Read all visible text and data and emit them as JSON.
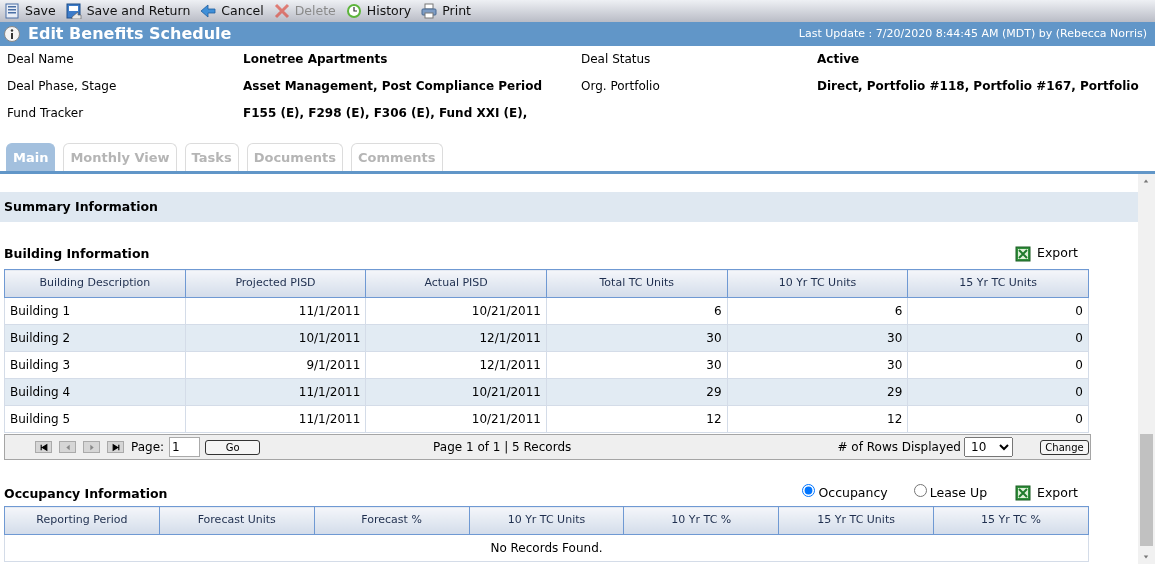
{
  "toolbar": [
    {
      "label": "Save",
      "disabled": false
    },
    {
      "label": "Save and Return",
      "disabled": false
    },
    {
      "label": "Cancel",
      "disabled": false
    },
    {
      "label": "Delete",
      "disabled": true
    },
    {
      "label": "History",
      "disabled": false
    },
    {
      "label": "Print",
      "disabled": false
    }
  ],
  "title": "Edit Benefits Schedule",
  "last_update": "Last Update : 7/20/2020 8:44:45 AM (MDT) by (Rebecca Norris)",
  "deal_fields": [
    {
      "label": "Deal Name",
      "value": "Lonetree Apartments"
    },
    {
      "label": "Deal Status",
      "value": "Active"
    },
    {
      "label": "Deal Phase, Stage",
      "value": "Asset Management, Post Compliance Period"
    },
    {
      "label": "Org. Portfolio",
      "value": "Direct, Portfolio #118, Portfolio #167, Portfolio"
    },
    {
      "label": "Fund Tracker",
      "value": "F155 (E), F298 (E), F306 (E), Fund XXI (E),"
    }
  ],
  "tabs": [
    {
      "label": "Main",
      "selected": true
    },
    {
      "label": "Monthly View",
      "selected": false
    },
    {
      "label": "Tasks",
      "selected": false
    },
    {
      "label": "Documents",
      "selected": false
    },
    {
      "label": "Comments",
      "selected": false
    }
  ],
  "summary_header": "Summary Information",
  "building": {
    "title": "Building Information",
    "export": "Export",
    "columns": [
      "Building Description",
      "Projected PISD",
      "Actual PISD",
      "Total TC Units",
      "10 Yr TC Units",
      "15 Yr TC Units"
    ],
    "rows": [
      [
        "Building 1",
        "11/1/2011",
        "10/21/2011",
        "6",
        "6",
        "0"
      ],
      [
        "Building 2",
        "10/1/2011",
        "12/1/2011",
        "30",
        "30",
        "0"
      ],
      [
        "Building 3",
        "9/1/2011",
        "12/1/2011",
        "30",
        "30",
        "0"
      ],
      [
        "Building 4",
        "11/1/2011",
        "10/21/2011",
        "29",
        "29",
        "0"
      ],
      [
        "Building 5",
        "11/1/2011",
        "10/21/2011",
        "12",
        "12",
        "0"
      ]
    ],
    "pager": {
      "page_label": "Page:",
      "page_value": "1",
      "go": "Go",
      "summary": "Page 1 of 1 | 5 Records",
      "rows_label": "# of Rows Displayed",
      "rows_value": "10",
      "change": "Change"
    }
  },
  "occupancy": {
    "title": "Occupancy Information",
    "export": "Export",
    "options": [
      {
        "label": "Occupancy",
        "selected": true
      },
      {
        "label": "Lease Up",
        "selected": false
      }
    ],
    "columns": [
      "Reporting Period",
      "Forecast Units",
      "Forecast %",
      "10 Yr TC Units",
      "10 Yr TC %",
      "15 Yr TC Units",
      "15 Yr TC %"
    ],
    "empty": "No Records Found."
  }
}
